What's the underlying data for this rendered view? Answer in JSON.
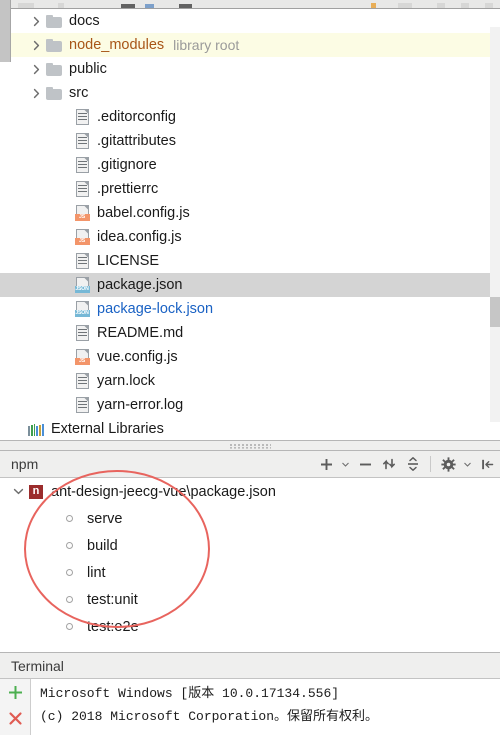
{
  "window": {
    "app": "IntelliJ IDEA Project View"
  },
  "project_tree": {
    "items": [
      {
        "label": "docs",
        "type": "folder",
        "indent": 1,
        "expandable": true,
        "expanded": false,
        "state": "normal",
        "sublabel": ""
      },
      {
        "label": "node_modules",
        "type": "folder",
        "indent": 1,
        "expandable": true,
        "expanded": false,
        "state": "library",
        "sublabel": "library root"
      },
      {
        "label": "public",
        "type": "folder",
        "indent": 1,
        "expandable": true,
        "expanded": false,
        "state": "normal",
        "sublabel": ""
      },
      {
        "label": "src",
        "type": "folder",
        "indent": 1,
        "expandable": true,
        "expanded": false,
        "state": "normal",
        "sublabel": ""
      },
      {
        "label": ".editorconfig",
        "type": "file",
        "indent": 2,
        "expandable": false,
        "expanded": false,
        "state": "normal",
        "sublabel": ""
      },
      {
        "label": ".gitattributes",
        "type": "file",
        "indent": 2,
        "expandable": false,
        "expanded": false,
        "state": "normal",
        "sublabel": ""
      },
      {
        "label": ".gitignore",
        "type": "file",
        "indent": 2,
        "expandable": false,
        "expanded": false,
        "state": "normal",
        "sublabel": ""
      },
      {
        "label": ".prettierrc",
        "type": "file",
        "indent": 2,
        "expandable": false,
        "expanded": false,
        "state": "normal",
        "sublabel": ""
      },
      {
        "label": "babel.config.js",
        "type": "file-js",
        "indent": 2,
        "expandable": false,
        "expanded": false,
        "state": "normal",
        "sublabel": ""
      },
      {
        "label": "idea.config.js",
        "type": "file-js",
        "indent": 2,
        "expandable": false,
        "expanded": false,
        "state": "normal",
        "sublabel": ""
      },
      {
        "label": "LICENSE",
        "type": "file",
        "indent": 2,
        "expandable": false,
        "expanded": false,
        "state": "normal",
        "sublabel": ""
      },
      {
        "label": "package.json",
        "type": "file-json",
        "indent": 2,
        "expandable": false,
        "expanded": false,
        "state": "selected",
        "sublabel": ""
      },
      {
        "label": "package-lock.json",
        "type": "file-json",
        "indent": 2,
        "expandable": false,
        "expanded": false,
        "state": "link",
        "sublabel": ""
      },
      {
        "label": "README.md",
        "type": "file",
        "indent": 2,
        "expandable": false,
        "expanded": false,
        "state": "normal",
        "sublabel": ""
      },
      {
        "label": "vue.config.js",
        "type": "file-js",
        "indent": 2,
        "expandable": false,
        "expanded": false,
        "state": "normal",
        "sublabel": ""
      },
      {
        "label": "yarn.lock",
        "type": "file",
        "indent": 2,
        "expandable": false,
        "expanded": false,
        "state": "normal",
        "sublabel": ""
      },
      {
        "label": "yarn-error.log",
        "type": "file",
        "indent": 2,
        "expandable": false,
        "expanded": false,
        "state": "normal",
        "sublabel": ""
      },
      {
        "label": "External Libraries",
        "type": "libraries",
        "indent": 0,
        "expandable": false,
        "expanded": false,
        "state": "normal",
        "sublabel": ""
      }
    ],
    "badges": {
      "js": "JS",
      "json": "JSON"
    }
  },
  "npm_panel": {
    "title": "npm",
    "toolbar": [
      {
        "name": "add-script-button",
        "glyph": "+",
        "dropdown": true
      },
      {
        "name": "remove-script-button",
        "glyph": "−",
        "dropdown": false
      },
      {
        "name": "rerun-button",
        "glyph": "↰",
        "dropdown": false
      },
      {
        "name": "collapse-all-button",
        "glyph": "÷",
        "dropdown": false
      },
      {
        "name": "settings-button",
        "glyph": "⚙",
        "dropdown": true
      },
      {
        "name": "hide-panel-button",
        "glyph": "⇥",
        "dropdown": false
      }
    ],
    "root": {
      "label": "ant-design-jeecg-vue\\package.json",
      "icon": "npm-icon",
      "icon_letter": "n",
      "expanded": true
    },
    "scripts": [
      {
        "label": "serve"
      },
      {
        "label": "build"
      },
      {
        "label": "lint"
      },
      {
        "label": "test:unit"
      },
      {
        "label": "test:e2e"
      }
    ],
    "annotation": {
      "shape": "ellipse",
      "color": "#e8645e"
    }
  },
  "terminal": {
    "title": "Terminal",
    "gutter": [
      {
        "name": "new-session-button",
        "glyph": "+"
      },
      {
        "name": "close-session-button",
        "glyph": "✕"
      }
    ],
    "lines": [
      "Microsoft Windows [版本 10.0.17134.556]",
      "(c) 2018 Microsoft Corporation。保留所有权利。"
    ]
  },
  "colors": {
    "selection": "#d4d4d4",
    "library_row": "#fcfce4",
    "link_text": "#1a62c4",
    "library_text": "#a85517",
    "annotation": "#e8645e",
    "npm_icon": "#9b2c2c",
    "terminal_plus": "#4caf50",
    "terminal_close": "#e05b52"
  }
}
